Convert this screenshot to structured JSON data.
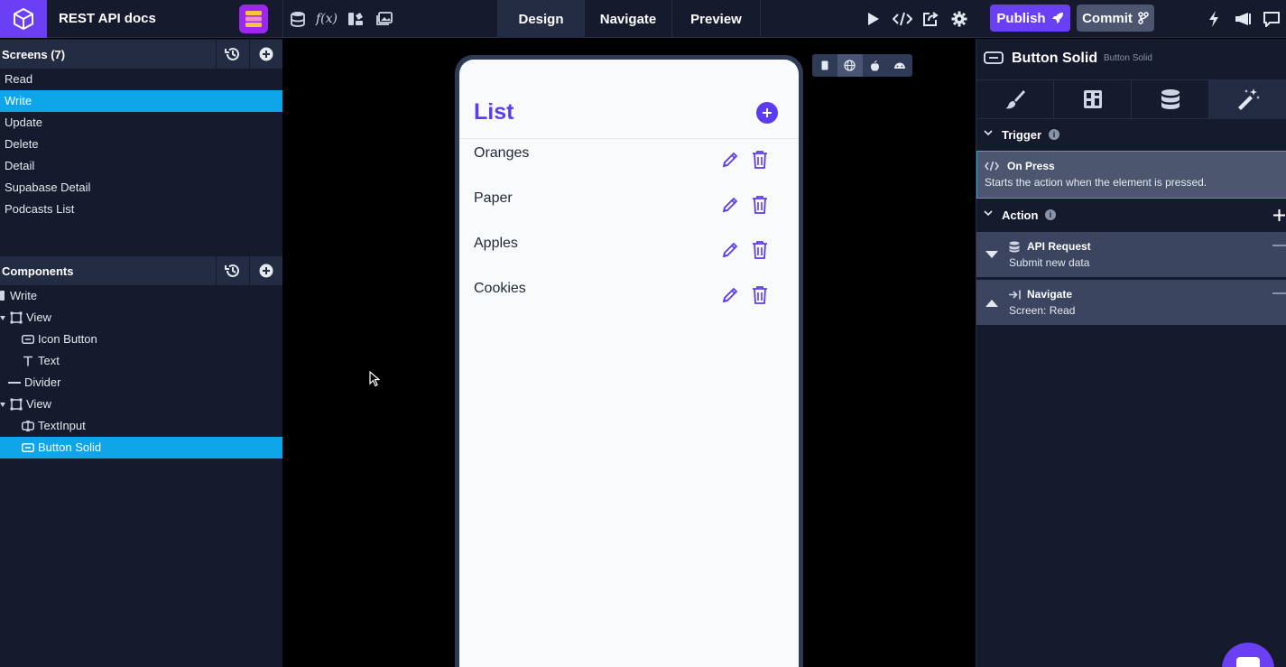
{
  "project": {
    "title": "REST API docs"
  },
  "tabs": [
    {
      "label": "Design"
    },
    {
      "label": "Navigate"
    },
    {
      "label": "Preview"
    }
  ],
  "toolbar": {
    "publish_label": "Publish",
    "commit_label": "Commit"
  },
  "screens": {
    "title": "Screens (7)",
    "items": [
      {
        "label": "Read"
      },
      {
        "label": "Write"
      },
      {
        "label": "Update"
      },
      {
        "label": "Delete"
      },
      {
        "label": "Detail"
      },
      {
        "label": "Supabase Detail"
      },
      {
        "label": "Podcasts List"
      }
    ],
    "selected": "Write"
  },
  "components": {
    "title": "Components",
    "items": [
      {
        "label": "Write"
      },
      {
        "label": "View"
      },
      {
        "label": "Icon Button"
      },
      {
        "label": "Text"
      },
      {
        "label": "Divider"
      },
      {
        "label": "View"
      },
      {
        "label": "TextInput"
      },
      {
        "label": "Button Solid"
      }
    ],
    "selected": "Button Solid"
  },
  "preview": {
    "list_title": "List",
    "items": [
      {
        "label": "Oranges"
      },
      {
        "label": "Paper"
      },
      {
        "label": "Apples"
      },
      {
        "label": "Cookies"
      }
    ]
  },
  "inspector": {
    "title": "Button Solid",
    "subtitle": "Button Solid",
    "trigger_section": "Trigger",
    "trigger": {
      "title": "On Press",
      "description": "Starts the action when the element is pressed."
    },
    "action_section": "Action",
    "actions": [
      {
        "title": "API Request",
        "description": "Submit new data"
      },
      {
        "title": "Navigate",
        "description": "Screen: Read"
      }
    ]
  },
  "colors": {
    "accent": "#6b40f5",
    "selection": "#0ea5e9",
    "list_accent": "#5b3cf0"
  }
}
